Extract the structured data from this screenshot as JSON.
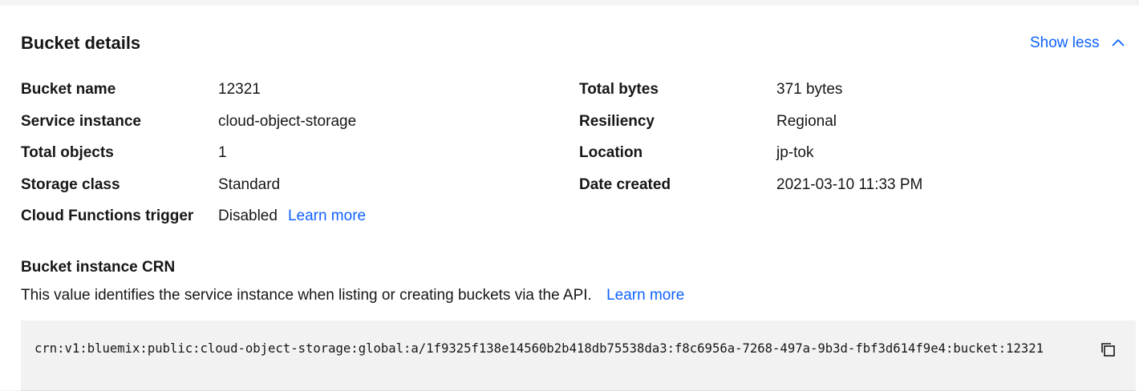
{
  "panel": {
    "title": "Bucket details",
    "toggle_label": "Show less"
  },
  "details": {
    "left": [
      {
        "label": "Bucket name",
        "value": "12321"
      },
      {
        "label": "Service instance",
        "value": "cloud-object-storage"
      },
      {
        "label": "Total objects",
        "value": "1"
      },
      {
        "label": "Storage class",
        "value": "Standard"
      },
      {
        "label": "Cloud Functions trigger",
        "value": "Disabled",
        "link": "Learn more"
      }
    ],
    "right": [
      {
        "label": "Total bytes",
        "value": "371 bytes"
      },
      {
        "label": "Resiliency",
        "value": "Regional"
      },
      {
        "label": "Location",
        "value": "jp-tok"
      },
      {
        "label": "Date created",
        "value": "2021-03-10 11:33 PM"
      }
    ]
  },
  "crn": {
    "heading": "Bucket instance CRN",
    "description": "This value identifies the service instance when listing or creating buckets via the API.",
    "link": "Learn more",
    "value": "crn:v1:bluemix:public:cloud-object-storage:global:a/1f9325f138e14560b2b418db75538da3:f8c6956a-7268-497a-9b3d-fbf3d614f9e4:bucket:12321"
  },
  "icons": {
    "toggle": "chevron-up-icon",
    "copy": "copy-icon"
  },
  "colors": {
    "link": "#0f62fe",
    "text": "#161616",
    "background": "#f4f4f4",
    "panel": "#ffffff",
    "code_background": "#f2f2f2"
  }
}
